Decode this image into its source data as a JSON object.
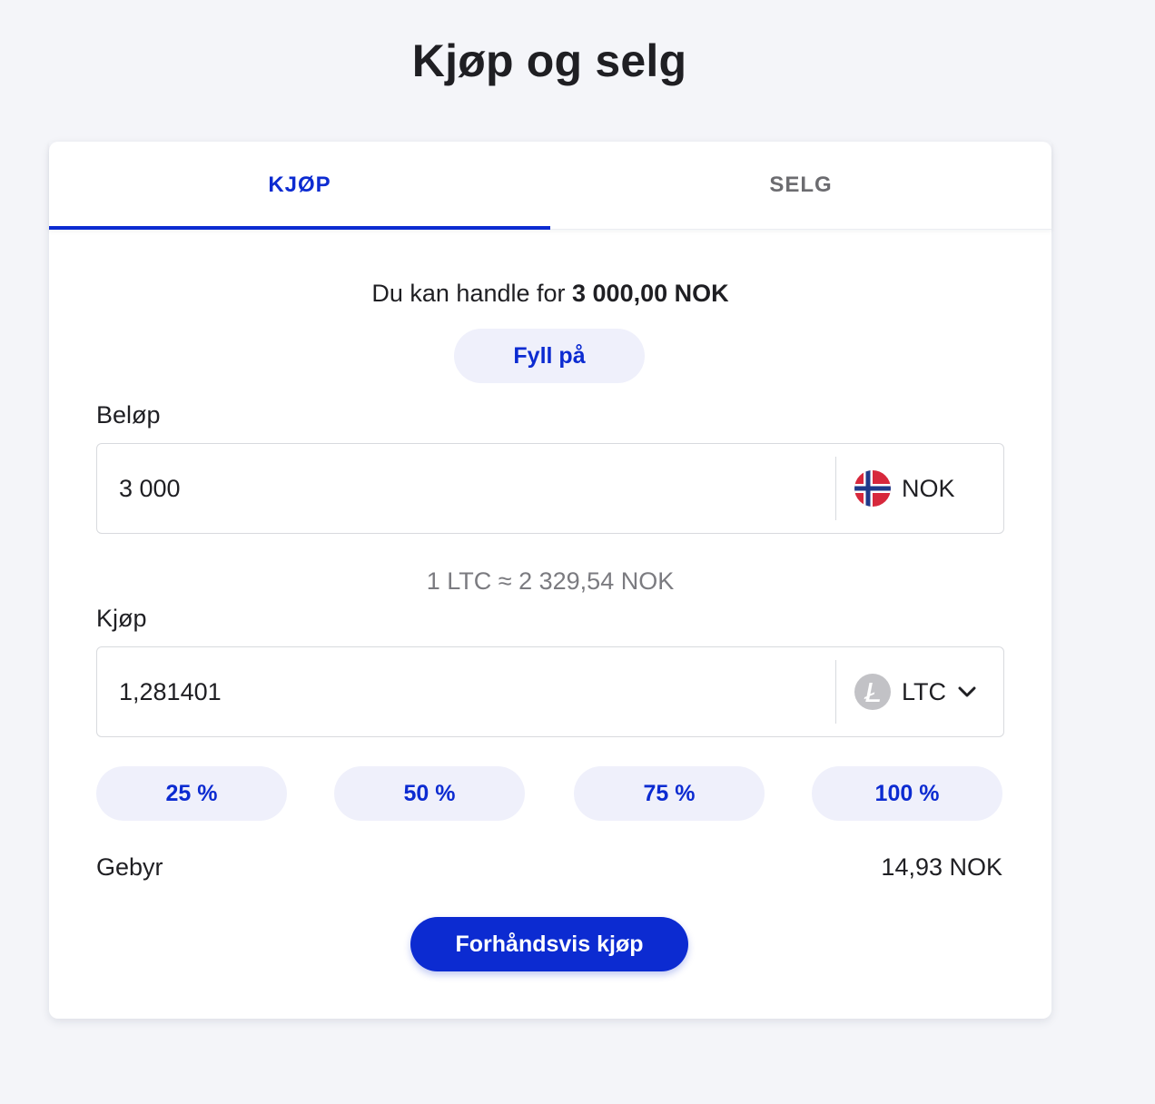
{
  "page": {
    "title": "Kjøp og selg"
  },
  "tabs": [
    {
      "label": "KJØP",
      "active": true
    },
    {
      "label": "SELG",
      "active": false
    }
  ],
  "balance": {
    "prefix": "Du kan handle for ",
    "amount": "3 000,00 NOK"
  },
  "topup_label": "Fyll på",
  "amount_field": {
    "label": "Beløp",
    "value": "3 000",
    "currency": "NOK",
    "currency_icon": "norway-flag-icon"
  },
  "rate_text": "1 LTC ≈ 2 329,54 NOK",
  "buy_field": {
    "label": "Kjøp",
    "value": "1,281401",
    "currency": "LTC",
    "currency_icon": "litecoin-icon"
  },
  "percent_buttons": [
    "25 %",
    "50 %",
    "75 %",
    "100 %"
  ],
  "fee": {
    "label": "Gebyr",
    "value": "14,93 NOK"
  },
  "preview_button_label": "Forhåndsvis kjøp",
  "colors": {
    "accent": "#0c2bd1",
    "background": "#f4f5f9",
    "pill_background": "#eff0fb",
    "muted_text": "#7b7b80"
  }
}
